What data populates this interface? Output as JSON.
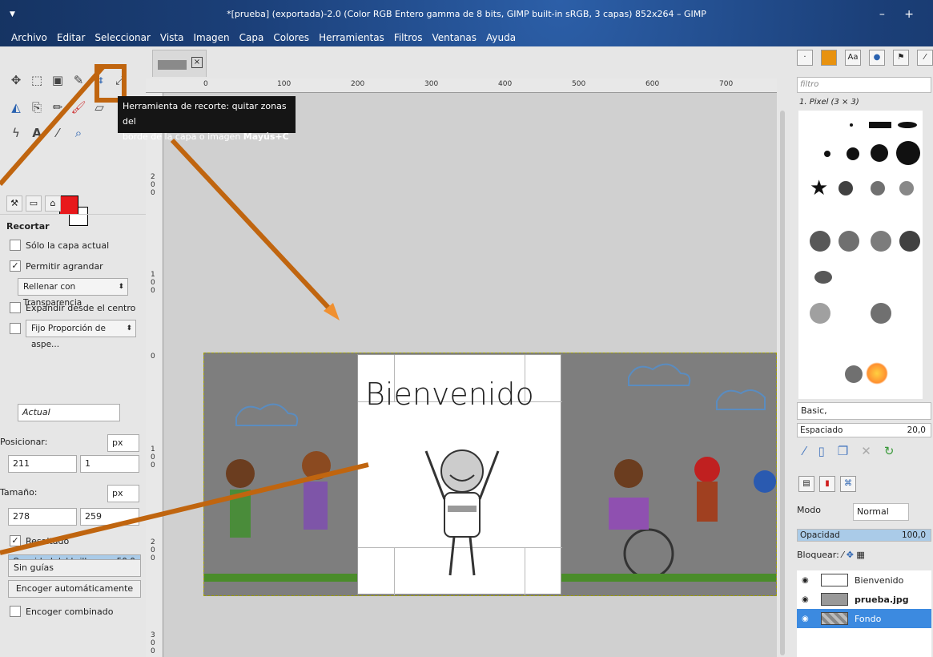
{
  "window": {
    "title": "*[prueba] (exportada)-2.0 (Color RGB Entero gamma de 8 bits, GIMP built-in sRGB, 3 capas) 852x264 – GIMP",
    "controls": "– +"
  },
  "menu": [
    "Archivo",
    "Editar",
    "Seleccionar",
    "Vista",
    "Imagen",
    "Capa",
    "Colores",
    "Herramientas",
    "Filtros",
    "Ventanas",
    "Ayuda"
  ],
  "tooltip": {
    "line1": "Herramienta de recorte: quitar zonas del",
    "line2": "borde de la capa o imagen",
    "shortcut": "Mayús+C"
  },
  "colors": {
    "foreground": "#e8191c",
    "background": "#ffffff",
    "highlight": "#c0650f"
  },
  "tool_options": {
    "title": "Recortar",
    "only_current_layer": "Sólo la capa actual",
    "allow_grow": "Permitir agrandar",
    "fill_with": "Rellenar con  Transparencia",
    "expand_center": "Expandir desde el centro",
    "fixed": "Fijo Proporción de aspe...",
    "actual": "Actual",
    "position_label": "Posicionar:",
    "unit": "px",
    "pos_x": "211",
    "pos_y": "1",
    "size_label": "Tamaño:",
    "size_w": "278",
    "size_h": "259",
    "highlight": "Resaltado",
    "highlight_opacity_label": "Opacidad del brillo",
    "highlight_opacity_value": "50,0",
    "guides": "Sin guías",
    "auto_shrink": "Encoger automáticamente",
    "shrink_merged": "Encoger combinado"
  },
  "ruler": {
    "top": [
      "0",
      "100",
      "200",
      "300",
      "400",
      "500",
      "600",
      "700"
    ],
    "left": [
      "200",
      "100",
      "0",
      "100",
      "200",
      "300"
    ]
  },
  "canvas": {
    "welcome_text": "Bienvenido"
  },
  "brushes": {
    "filter_placeholder": "filtro",
    "selected_brush": "1. Pixel (3 × 3)",
    "preset": "Basic,",
    "spacing_label": "Espaciado",
    "spacing_value": "20,0"
  },
  "layers_panel": {
    "mode_label": "Modo",
    "mode_value": "Normal",
    "opacity_label": "Opacidad",
    "opacity_value": "100,0",
    "lock_label": "Bloquear:",
    "layers": [
      "Bienvenido",
      "prueba.jpg",
      "Fondo"
    ]
  }
}
